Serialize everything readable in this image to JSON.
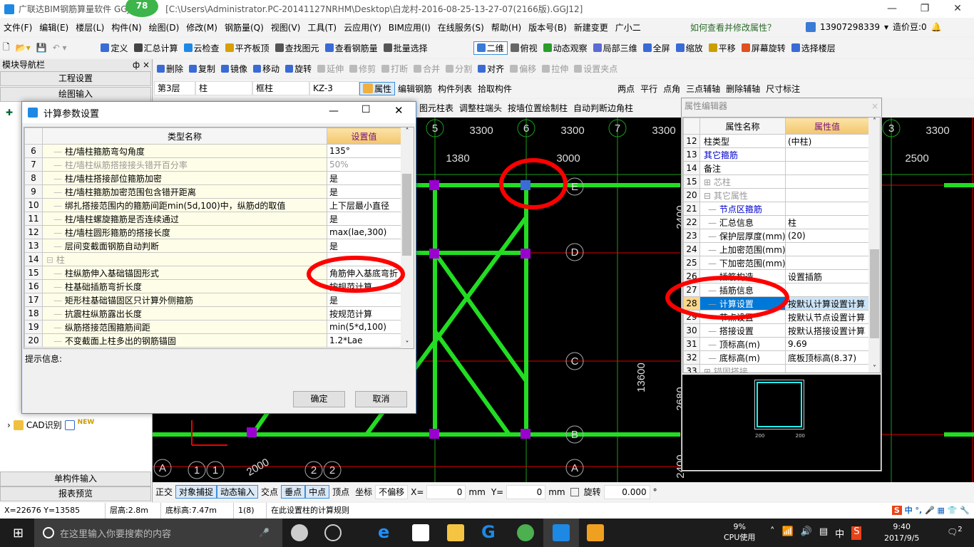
{
  "window": {
    "title": "广联达BIM钢筋算量软件 GGJ",
    "path": "[C:\\Users\\Administrator.PC-20141127NRHM\\Desktop\\白龙村-2016-08-25-13-27-07(2166版).GGJ12]",
    "badge": "78"
  },
  "menu": [
    "文件(F)",
    "编辑(E)",
    "楼层(L)",
    "构件(N)",
    "绘图(D)",
    "修改(M)",
    "钢筋量(Q)",
    "视图(V)",
    "工具(T)",
    "云应用(Y)",
    "BIM应用(I)",
    "在线服务(S)",
    "帮助(H)",
    "版本号(B)",
    "新建变更",
    "广小二"
  ],
  "help_link": "如何查看并修改属性？",
  "account": {
    "phone": "13907298339",
    "beans": "造价豆:0"
  },
  "toolbar1": [
    "定义",
    "汇总计算",
    "云检查",
    "平齐板顶",
    "查找图元",
    "查看钢筋量",
    "批量选择",
    "二维",
    "俯视",
    "动态观察",
    "局部三维",
    "全屏",
    "缩放",
    "平移",
    "屏幕旋转",
    "选择楼层"
  ],
  "toolbar2": [
    "删除",
    "复制",
    "镜像",
    "移动",
    "旋转",
    "延伸",
    "修剪",
    "打断",
    "合并",
    "分割",
    "对齐",
    "偏移",
    "拉伸",
    "设置夹点"
  ],
  "toolbar3": {
    "floor": "第3层",
    "type": "柱",
    "subtype": "框柱",
    "name": "KZ-3",
    "buttons": [
      "属性",
      "编辑钢筋",
      "构件列表",
      "拾取构件"
    ],
    "aux": [
      "两点",
      "平行",
      "点角",
      "三点辅轴",
      "删除辅轴",
      "尺寸标注"
    ]
  },
  "toolbar4": [
    "图元柱表",
    "调整柱端头",
    "按墙位置绘制柱",
    "自动判断边角柱"
  ],
  "nav": {
    "title": "模块导航栏",
    "pin": "ф",
    "close": "×",
    "project": "工程设置",
    "drawing": "绘图输入",
    "cad": "CAD识别",
    "new": "NEW",
    "single": "单构件输入",
    "report": "报表预览"
  },
  "dialog": {
    "title": "计算参数设置",
    "col_name": "类型名称",
    "col_value": "设置值",
    "rows": [
      {
        "n": "6",
        "name": "柱/墙柱箍筋弯勾角度",
        "value": "135°"
      },
      {
        "n": "7",
        "name": "柱/墙柱纵筋搭接接头错开百分率",
        "value": "50%",
        "disabled": true
      },
      {
        "n": "8",
        "name": "柱/墙柱搭接部位箍筋加密",
        "value": "是"
      },
      {
        "n": "9",
        "name": "柱/墙柱箍筋加密范围包含错开距离",
        "value": "是"
      },
      {
        "n": "10",
        "name": "绑扎搭接范围内的箍筋间距min(5d,100)中，纵筋d的取值",
        "value": "上下层最小直径"
      },
      {
        "n": "11",
        "name": "柱/墙柱螺旋箍筋是否连续通过",
        "value": "是"
      },
      {
        "n": "12",
        "name": "柱/墙柱圆形箍筋的搭接长度",
        "value": "max(lae,300)"
      },
      {
        "n": "13",
        "name": "层间变截面钢筋自动判断",
        "value": "是"
      },
      {
        "n": "14",
        "name": "柱",
        "value": "",
        "group": true
      },
      {
        "n": "15",
        "name": "柱纵筋伸入基础锚固形式",
        "value": "角筋伸入基底弯折"
      },
      {
        "n": "16",
        "name": "柱基础插筋弯折长度",
        "value": "按规范计算"
      },
      {
        "n": "17",
        "name": "矩形柱基础锚固区只计算外侧箍筋",
        "value": "是"
      },
      {
        "n": "18",
        "name": "抗震柱纵筋露出长度",
        "value": "按规范计算"
      },
      {
        "n": "19",
        "name": "纵筋搭接范围箍筋间距",
        "value": "min(5*d,100)"
      },
      {
        "n": "20",
        "name": "不变截面上柱多出的钢筋锚固",
        "value": "1.2*Lae"
      }
    ],
    "hint_label": "提示信息:",
    "ok": "确定",
    "cancel": "取消"
  },
  "property_editor": {
    "title": "属性编辑器",
    "col_name": "属性名称",
    "col_value": "属性值",
    "rows": [
      {
        "n": "12",
        "name": "柱类型",
        "value": "(中柱)"
      },
      {
        "n": "13",
        "name": "其它箍筋",
        "value": "",
        "link": true
      },
      {
        "n": "14",
        "name": "备注",
        "value": ""
      },
      {
        "n": "15",
        "name": "芯柱",
        "value": "",
        "group": "+"
      },
      {
        "n": "20",
        "name": "其它属性",
        "value": "",
        "group": "-"
      },
      {
        "n": "21",
        "name": "节点区箍筋",
        "value": "",
        "link": true,
        "child": true
      },
      {
        "n": "22",
        "name": "汇总信息",
        "value": "柱",
        "child": true
      },
      {
        "n": "23",
        "name": "保护层厚度(mm)",
        "value": "(20)",
        "child": true
      },
      {
        "n": "24",
        "name": "上加密范围(mm)",
        "value": "",
        "child": true
      },
      {
        "n": "25",
        "name": "下加密范围(mm)",
        "value": "",
        "child": true
      },
      {
        "n": "26",
        "name": "插筋构造",
        "value": "设置插筋",
        "child": true
      },
      {
        "n": "27",
        "name": "插筋信息",
        "value": "",
        "child": true
      },
      {
        "n": "28",
        "name": "计算设置",
        "value": "按默认计算设置计算",
        "child": true,
        "selected": true
      },
      {
        "n": "29",
        "name": "节点设置",
        "value": "按默认节点设置计算",
        "child": true
      },
      {
        "n": "30",
        "name": "搭接设置",
        "value": "按默认搭接设置计算",
        "child": true
      },
      {
        "n": "31",
        "name": "顶标高(m)",
        "value": "9.69",
        "child": true
      },
      {
        "n": "32",
        "name": "底标高(m)",
        "value": "底板顶标高(8.37)",
        "child": true
      },
      {
        "n": "33",
        "name": "锚固搭接",
        "value": "",
        "group": "+"
      }
    ],
    "preview_dims": [
      "200",
      "200"
    ]
  },
  "canvas": {
    "axes_top": [
      "5",
      "6",
      "7",
      "3"
    ],
    "dims_top": [
      "3300",
      "3300",
      "3300",
      "3300"
    ],
    "dims_row2": [
      "1380",
      "3000",
      "2500"
    ],
    "axes_side": [
      "E",
      "D",
      "C",
      "B",
      "A"
    ],
    "vertical_dims": [
      "13600",
      "2400",
      "2680",
      "2400"
    ],
    "axes_bottom": [
      "A",
      "1",
      "1",
      "2",
      "2"
    ],
    "dim_bottom": "2000",
    "colors": {
      "background": "#000000",
      "beam": "#22dd22",
      "grid": "#1a9e1a",
      "axis_red": "#dd0000",
      "column": "#9b00d0",
      "annotation": "#ff0000"
    }
  },
  "bottom_toolbar": {
    "items": [
      "正交",
      "对象捕捉",
      "动态输入",
      "交点",
      "垂点",
      "中点",
      "顶点",
      "坐标"
    ],
    "offset": "不偏移",
    "x_label": "X=",
    "x": "0",
    "y_label": "Y=",
    "y": "0",
    "unit": "mm",
    "rotate": "旋转",
    "angle": "0.000",
    "deg": "°"
  },
  "status": {
    "coords": "X=22676 Y=13585",
    "floor_height": "层高:2.8m",
    "base_elev": "底标高:7.47m",
    "count": "1(8)",
    "message": "在此设置柱的计算规则"
  },
  "taskbar": {
    "search": "在这里输入你要搜索的内容",
    "cpu": "9%",
    "cpu_label": "CPU使用",
    "ime": "中",
    "time": "9:40",
    "date": "2017/9/5",
    "notif": "2"
  }
}
